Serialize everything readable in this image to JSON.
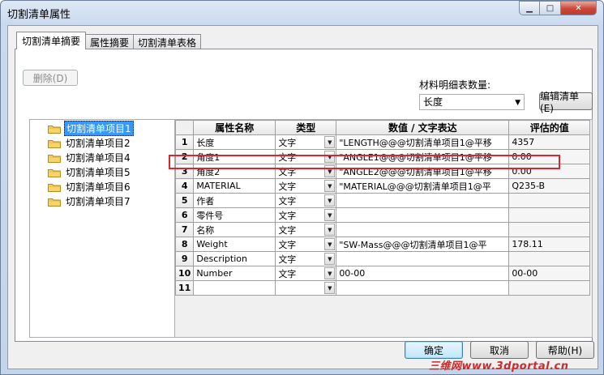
{
  "window": {
    "title": "切割清单属性"
  },
  "tabs": [
    {
      "label": "切割清单摘要"
    },
    {
      "label": "属性摘要"
    },
    {
      "label": "切割清单表格"
    }
  ],
  "toolbar": {
    "delete_label": "删除(D)",
    "bom_count_label": "材料明细表数量:",
    "bom_count_value": "长度",
    "edit_list_label": "编辑清单(E)"
  },
  "tree": {
    "items": [
      {
        "label": "切割清单项目1"
      },
      {
        "label": "切割清单项目2"
      },
      {
        "label": "切割清单项目4"
      },
      {
        "label": "切割清单项目5"
      },
      {
        "label": "切割清单项目6"
      },
      {
        "label": "切割清单项目7"
      }
    ]
  },
  "grid": {
    "headers": [
      "属性名称",
      "类型",
      "数值 / 文字表达",
      "评估的值"
    ],
    "rows": [
      {
        "n": "1",
        "name": "长度",
        "type": "文字",
        "expr": "\"LENGTH@@@切割清单项目1@平移",
        "value": "4357"
      },
      {
        "n": "2",
        "name": "角度1",
        "type": "文字",
        "expr": "\"ANGLE1@@@切割清单项目1@平移",
        "value": "0.00"
      },
      {
        "n": "3",
        "name": "角度2",
        "type": "文字",
        "expr": "\"ANGLE2@@@切割清单项目1@平移",
        "value": "0.00"
      },
      {
        "n": "4",
        "name": "MATERIAL",
        "type": "文字",
        "expr": "\"MATERIAL@@@切割清单项目1@平",
        "value": "Q235-B"
      },
      {
        "n": "5",
        "name": "作者",
        "type": "文字",
        "expr": "",
        "value": ""
      },
      {
        "n": "6",
        "name": "零件号",
        "type": "文字",
        "expr": "",
        "value": ""
      },
      {
        "n": "7",
        "name": "名称",
        "type": "文字",
        "expr": "",
        "value": ""
      },
      {
        "n": "8",
        "name": "Weight",
        "type": "文字",
        "expr": "\"SW-Mass@@@切割清单项目1@平",
        "value": "178.11"
      },
      {
        "n": "9",
        "name": "Description",
        "type": "文字",
        "expr": "",
        "value": ""
      },
      {
        "n": "10",
        "name": "Number",
        "type": "文字",
        "expr": "00-00",
        "value": "00-00"
      },
      {
        "n": "11",
        "name": "",
        "type": "",
        "expr": "",
        "value": ""
      }
    ]
  },
  "footer": {
    "ok_label": "确定",
    "cancel_label": "取消",
    "help_label": "帮助(H)"
  },
  "watermark": "三维网www.3dportal.cn",
  "colors": {
    "highlight": "#d9262f",
    "selection": "#3399ff"
  }
}
